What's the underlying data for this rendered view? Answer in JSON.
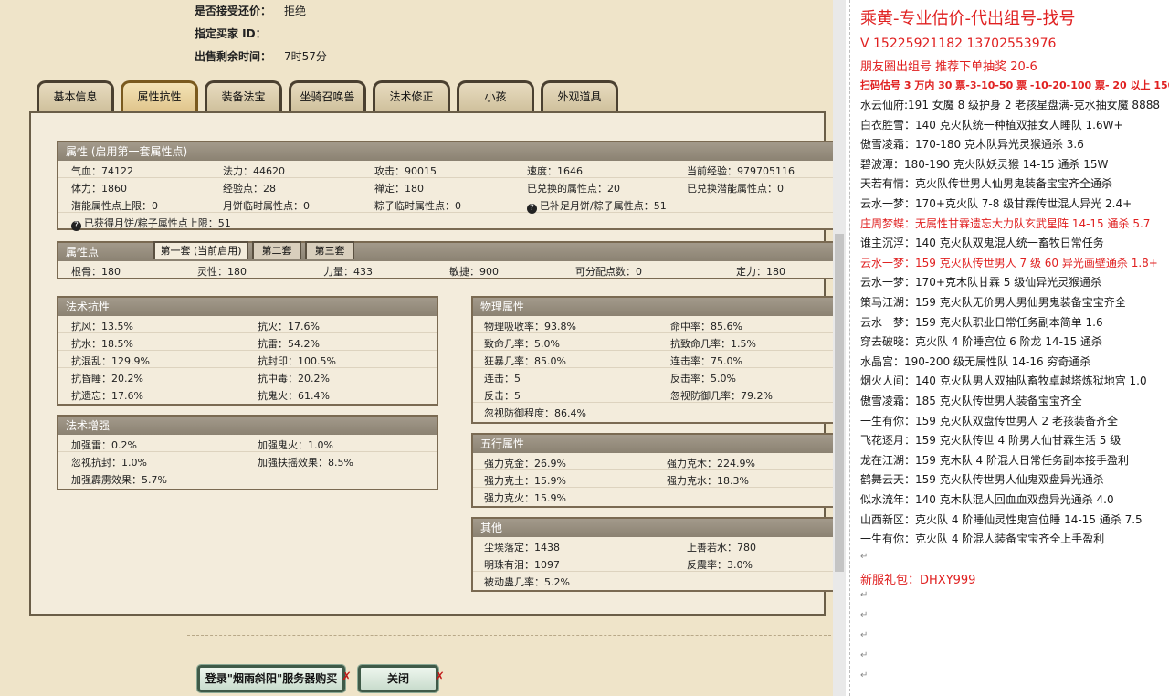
{
  "header_info": {
    "accept_counter_label": "是否接受还价：",
    "accept_counter_value": "拒绝",
    "buyer_id_label": "指定买家 ID：",
    "time_left_label": "出售剩余时间：",
    "time_left_value": "7时57分"
  },
  "tabs": [
    "基本信息",
    "属性抗性",
    "装备法宝",
    "坐骑召唤兽",
    "法术修正",
    "小孩",
    "外观道具"
  ],
  "attributes": {
    "title": "属性 (启用第一套属性点)",
    "rows": [
      [
        "气血：74122",
        "法力：44620",
        "攻击：90015",
        "速度：1646",
        "当前经验：979705116"
      ],
      [
        "体力：1860",
        "经验点：28",
        "禅定：180",
        "已兑换的属性点：20",
        "已兑换潜能属性点：0"
      ],
      [
        "潜能属性点上限：0",
        "月饼临时属性点：0",
        "粽子临时属性点：0",
        "已补足月饼/粽子属性点：51"
      ],
      [
        "已获得月饼/粽子属性点上限：51"
      ]
    ]
  },
  "attr_points": {
    "title": "属性点",
    "subtabs": [
      "第一套 (当前启用)",
      "第二套",
      "第三套"
    ],
    "row": [
      "根骨：180",
      "灵性：180",
      "力量：433",
      "敏捷：900",
      "可分配点数：0",
      "定力：180"
    ]
  },
  "spell_resist": {
    "title": "法术抗性",
    "rows": [
      [
        "抗风：13.5%",
        "抗火：17.6%"
      ],
      [
        "抗水：18.5%",
        "抗雷：54.2%"
      ],
      [
        "抗混乱：129.9%",
        "抗封印：100.5%"
      ],
      [
        "抗昏睡：20.2%",
        "抗中毒：20.2%"
      ],
      [
        "抗遗忘：17.6%",
        "抗鬼火：61.4%"
      ]
    ]
  },
  "spell_boost": {
    "title": "法术增强",
    "rows": [
      [
        "加强雷：0.2%",
        "加强鬼火：1.0%"
      ],
      [
        "忽视抗封：1.0%",
        "加强扶摇效果：8.5%"
      ],
      [
        "加强霹雳效果：5.7%"
      ]
    ]
  },
  "physical": {
    "title": "物理属性",
    "rows": [
      [
        "物理吸收率：93.8%",
        "命中率：85.6%"
      ],
      [
        "致命几率：5.0%",
        "抗致命几率：1.5%"
      ],
      [
        "狂暴几率：85.0%",
        "连击率：75.0%"
      ],
      [
        "连击：5",
        "反击率：5.0%"
      ],
      [
        "反击：5",
        "忽视防御几率：79.2%"
      ],
      [
        "忽视防御程度：86.4%"
      ]
    ]
  },
  "five_elements": {
    "title": "五行属性",
    "rows": [
      [
        "强力克金：26.9%",
        "强力克木：224.9%"
      ],
      [
        "强力克土：15.9%",
        "强力克水：18.3%"
      ],
      [
        "强力克火：15.9%"
      ]
    ]
  },
  "other": {
    "title": "其他",
    "rows": [
      [
        "尘埃落定：1438",
        "上善若水：780"
      ],
      [
        "明珠有泪：1097",
        "反震率：3.0%"
      ],
      [
        "被动蛊几率：5.2%"
      ]
    ]
  },
  "buttons": {
    "login_buy": "登录\"烟雨斜阳\"服务器购买",
    "close": "关闭"
  },
  "sidebar": {
    "title": "乘黄-专业估价-代出组号-找号",
    "phone": "V   15225921182   13702553976",
    "promo": "朋友圈出组号  推荐下单抽奖 20-6",
    "scan": "扫码估号 3 万内 30 票-3-10-50 票  -10-20-100 票- 20 以上 150",
    "lines": [
      {
        "t": "水云仙府:191 女魔 8 级护身 2 老孩星盘满-克水抽女魔 8888",
        "red": false
      },
      {
        "t": "白衣胜雪：140 克火队统一种植双抽女人睡队 1.6W+",
        "red": false
      },
      {
        "t": "傲雪凌霜：170-180 克木队异光灵猴通杀 3.6",
        "red": false
      },
      {
        "t": "碧波潭：180-190 克火队妖灵猴 14-15 通杀 15W",
        "red": false
      },
      {
        "t": "天若有情：克火队传世男人仙男鬼装备宝宝齐全通杀",
        "red": false
      },
      {
        "t": "云水一梦：170+克火队 7-8 级甘霖传世混人异光 2.4+",
        "red": false
      },
      {
        "t": "庄周梦蝶：无属性甘霖遗忘大力队玄武星阵 14-15 通杀 5.7",
        "red": true
      },
      {
        "t": "谁主沉浮：140 克火队双鬼混人统一畜牧日常任务",
        "red": false
      },
      {
        "t": "云水一梦：159 克火队传世男人 7 级 60 异光画壁通杀 1.8+",
        "red": true
      },
      {
        "t": "云水一梦：170+克木队甘霖 5 级仙异光灵猴通杀",
        "red": false
      },
      {
        "t": "策马江湖：159 克火队无价男人男仙男鬼装备宝宝齐全",
        "red": false
      },
      {
        "t": "云水一梦：159 克火队职业日常任务副本简单 1.6",
        "red": false
      },
      {
        "t": "穿去破晓：克火队 4 阶睡宫位 6 阶龙 14-15 通杀",
        "red": false
      },
      {
        "t": "水晶宫：190-200 级无属性队 14-16 穷奇通杀",
        "red": false
      },
      {
        "t": "烟火人间：140 克火队男人双抽队畜牧卓越塔炼狱地宫 1.0",
        "red": false
      },
      {
        "t": "傲雪凌霜：185 克火队传世男人装备宝宝齐全",
        "red": false
      },
      {
        "t": "一生有你：159 克火队双盘传世男人 2 老孩装备齐全",
        "red": false
      },
      {
        "t": "飞花逐月：159 克火队传世 4 阶男人仙甘霖生活 5 级",
        "red": false
      },
      {
        "t": "龙在江湖：159 克木队 4 阶混人日常任务副本接手盈利",
        "red": false
      },
      {
        "t": "鹤舞云天：159 克火队传世男人仙鬼双盘异光通杀",
        "red": false
      },
      {
        "t": "似水流年：140 克木队混人回血血双盘异光通杀 4.0",
        "red": false
      },
      {
        "t": "山西新区：克火队 4 阶睡仙灵性鬼宫位睡 14-15 通杀 7.5",
        "red": false
      },
      {
        "t": "一生有你：克火队 4 阶混人装备宝宝齐全上手盈利",
        "red": false
      }
    ],
    "gift": "新服礼包：DHXY999"
  }
}
